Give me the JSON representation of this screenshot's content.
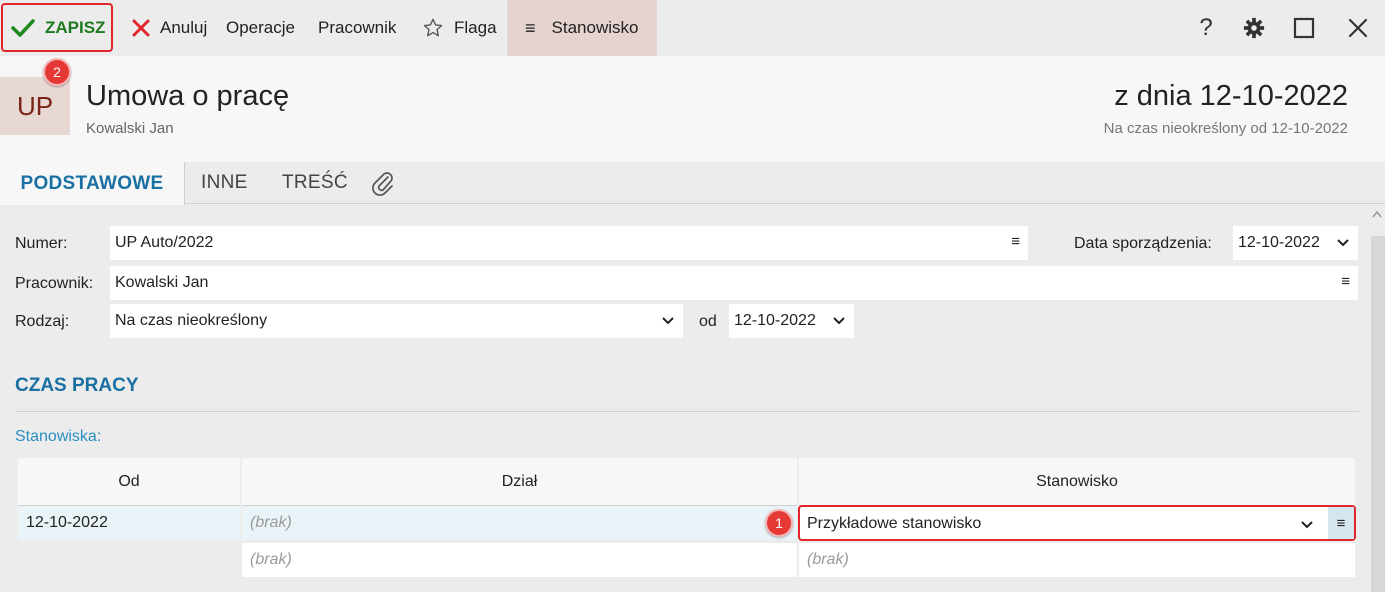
{
  "toolbar": {
    "save_label": "ZAPISZ",
    "cancel_label": "Anuluj",
    "operations_label": "Operacje",
    "employee_label": "Pracownik",
    "flag_label": "Flaga",
    "position_label": "Stanowisko",
    "help_label": "?"
  },
  "badges": {
    "save": "2",
    "position": "1"
  },
  "header": {
    "icon_text": "UP",
    "title": "Umowa o pracę",
    "subtitle": "Kowalski Jan",
    "date_title": "z dnia 12-10-2022",
    "date_subtitle": "Na czas nieokreślony od 12-10-2022"
  },
  "tabs": [
    {
      "label": "PODSTAWOWE"
    },
    {
      "label": "INNE"
    },
    {
      "label": "TREŚĆ"
    }
  ],
  "form": {
    "number_label": "Numer:",
    "number_value": "UP Auto/2022",
    "created_label": "Data sporządzenia:",
    "created_value": "12-10-2022",
    "employee_label": "Pracownik:",
    "employee_value": "Kowalski Jan",
    "type_label": "Rodzaj:",
    "type_value": "Na czas nieokreślony",
    "from_label": "od",
    "from_value": "12-10-2022"
  },
  "section": {
    "title": "CZAS PRACY",
    "subhead": "Stanowiska:"
  },
  "grid": {
    "headers": [
      "Od",
      "Dział",
      "Stanowisko"
    ],
    "rows": [
      {
        "from": "12-10-2022",
        "department": "(brak)",
        "position": "Przykładowe stanowisko"
      },
      {
        "from": "",
        "department": "(brak)",
        "position": "(brak)"
      }
    ]
  },
  "colors": {
    "accent": "#1a6fa3",
    "highlight": "#e0252b",
    "save_green": "#1e7a1e"
  }
}
